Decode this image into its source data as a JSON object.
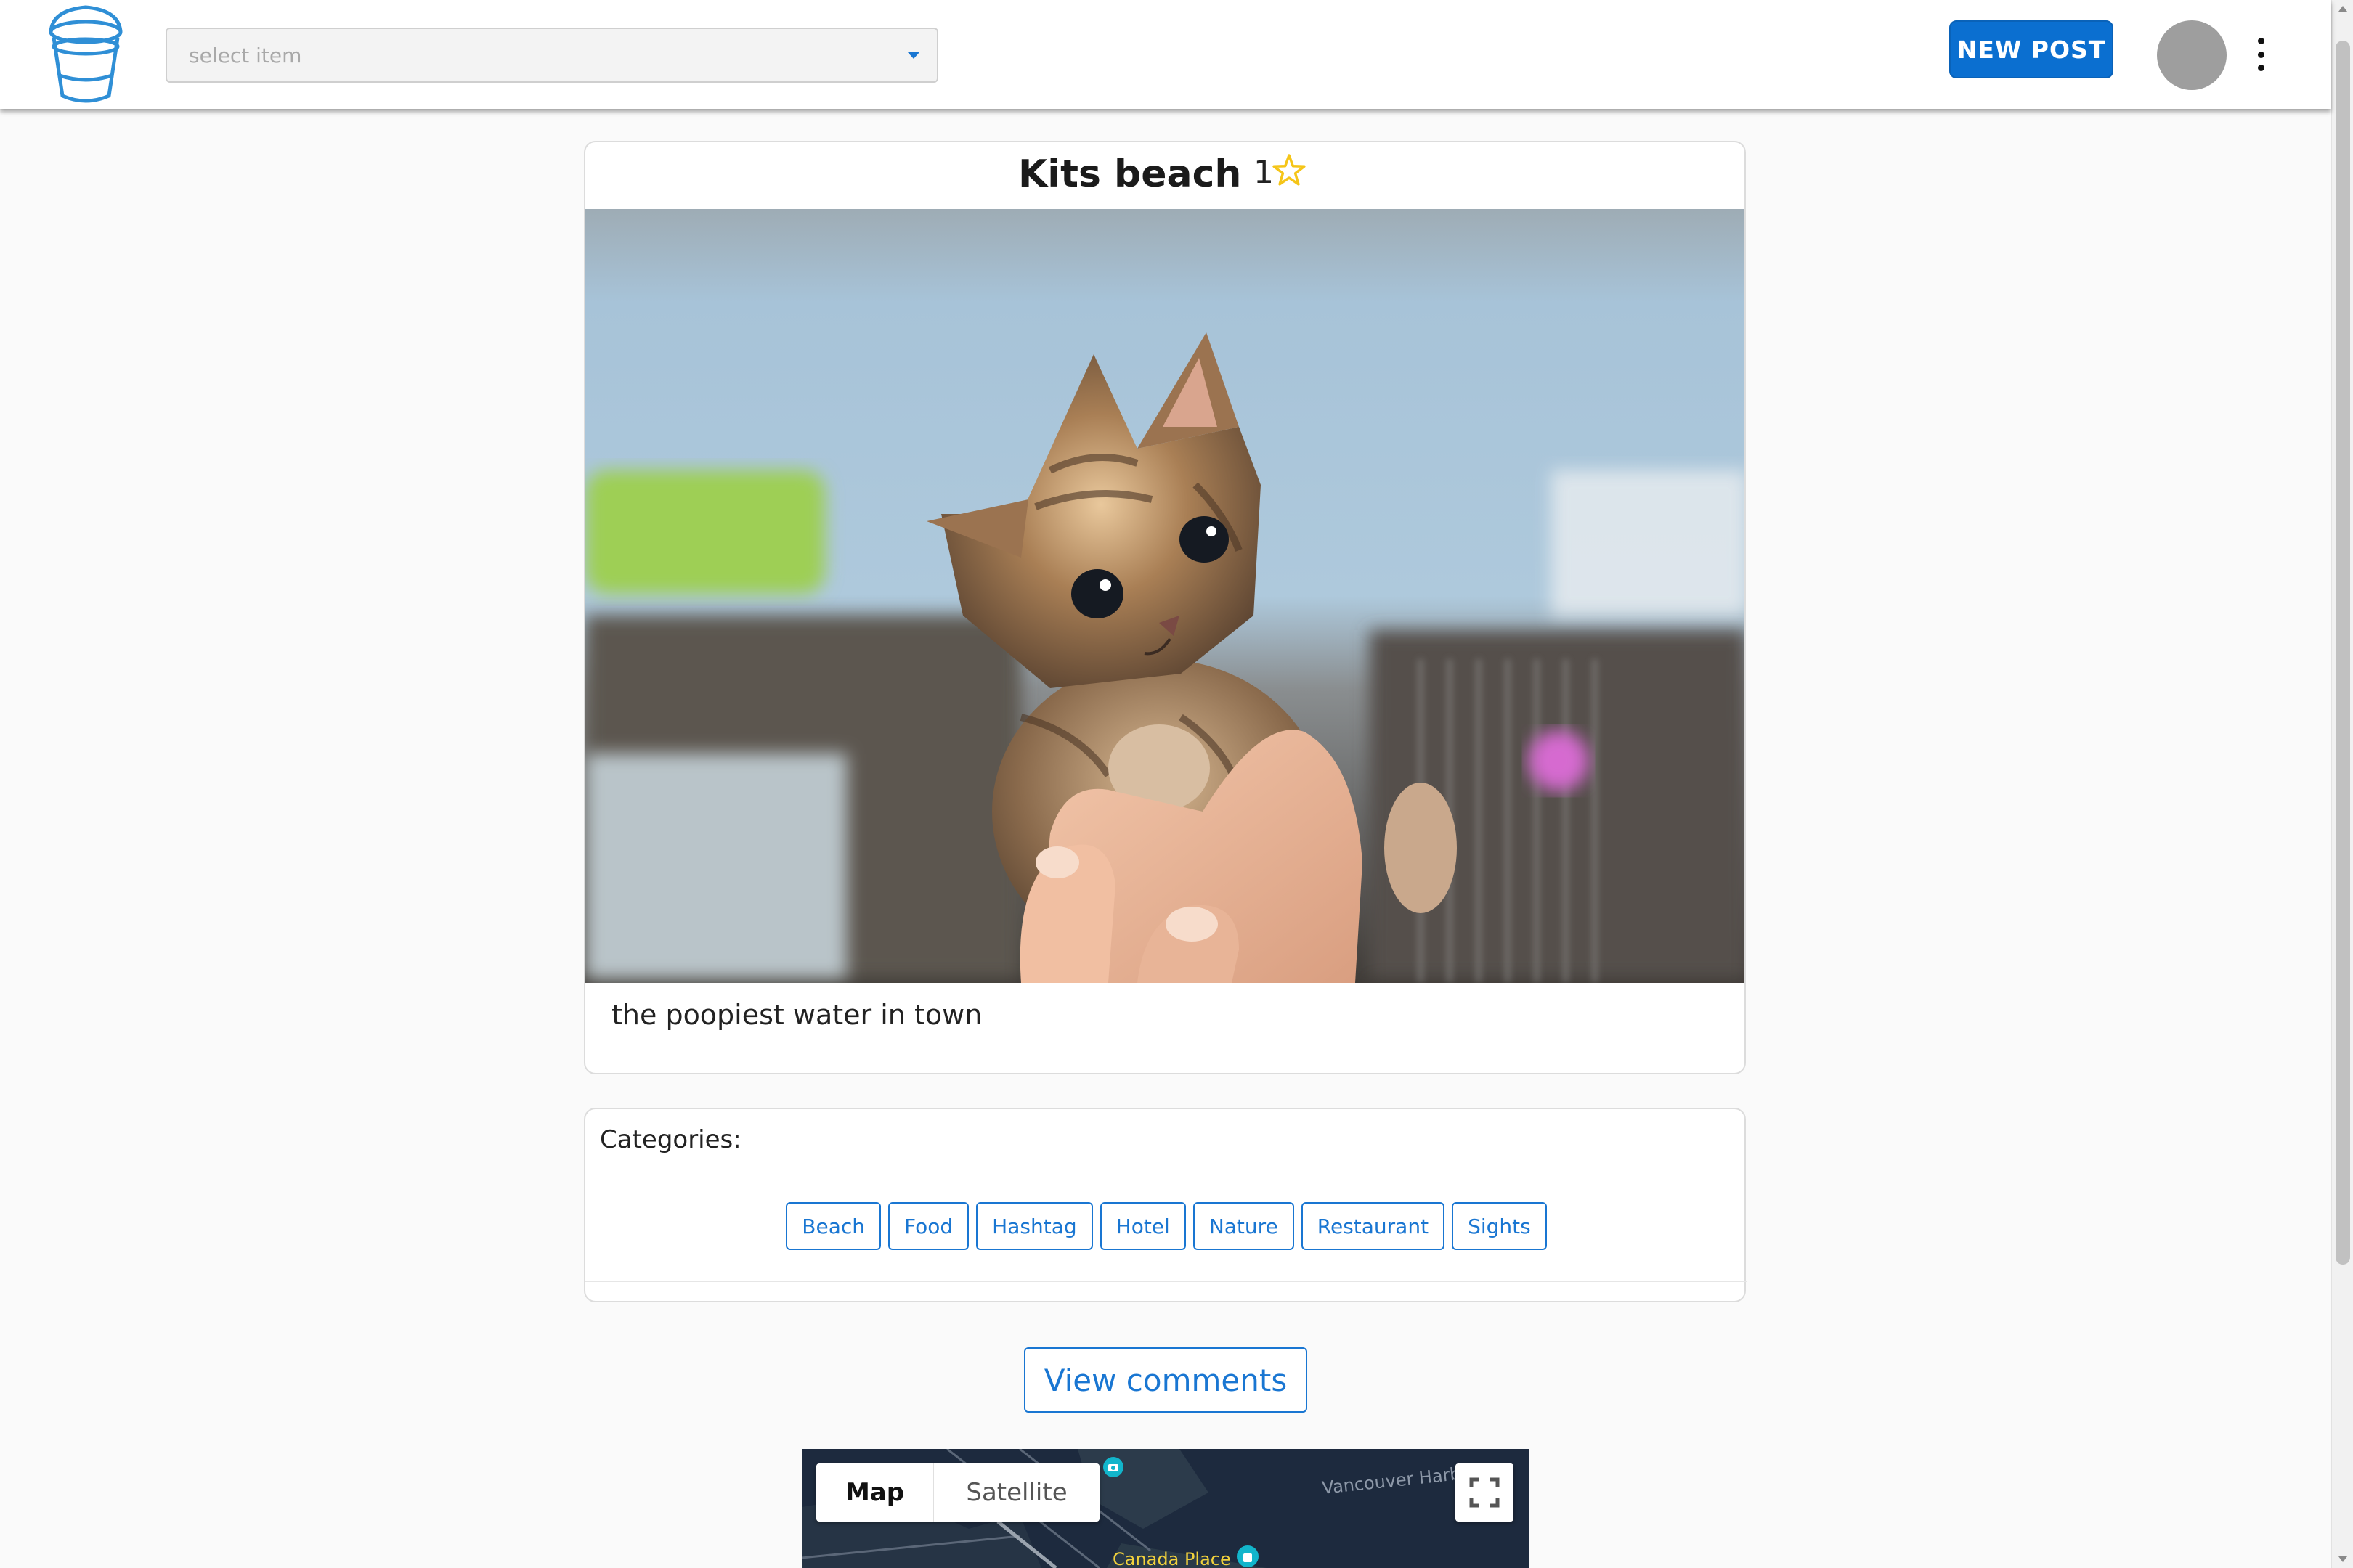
{
  "header": {
    "search": {
      "placeholder": "select item"
    },
    "new_post_label": "NEW POST"
  },
  "post": {
    "title": "Kits beach",
    "rating": "1",
    "caption": "the poopiest water in town"
  },
  "categories": {
    "label": "Categories:",
    "items": [
      "Beach",
      "Food",
      "Hashtag",
      "Hotel",
      "Nature",
      "Restaurant",
      "Sights"
    ]
  },
  "comments": {
    "view_label": "View comments"
  },
  "map": {
    "tabs": {
      "map": "Map",
      "satellite": "Satellite"
    },
    "labels": {
      "harbour": "Vancouver Harb",
      "canada_place": "Canada Place"
    }
  },
  "colors": {
    "accent": "#1976d2",
    "new_post_bg": "#0b6fd0",
    "star": "#f5c518",
    "map_bg": "#1d2a3e"
  },
  "icons": [
    "bucket-logo-icon",
    "chevron-down-icon",
    "more-vert-icon",
    "star-outline-icon",
    "fullscreen-icon",
    "camera-pin-icon",
    "shopping-pin-icon"
  ]
}
